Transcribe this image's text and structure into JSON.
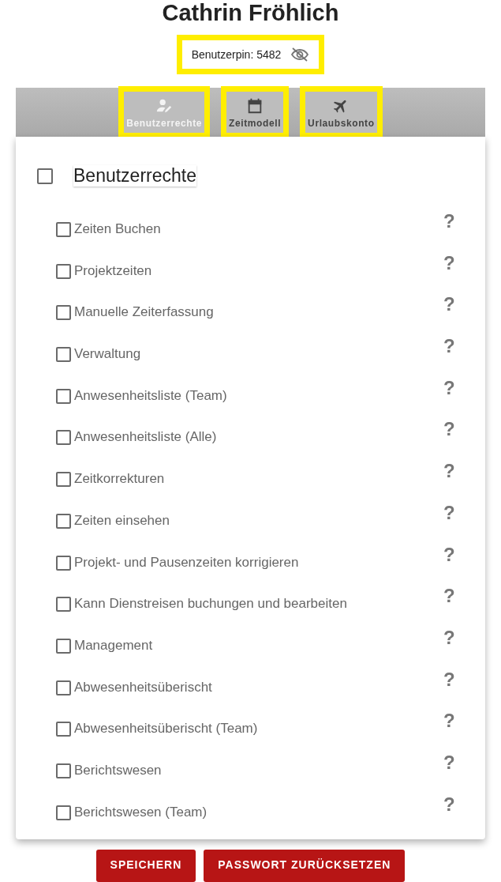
{
  "title": "Cathrin Fröhlich",
  "pin": {
    "label": "Benutzerpin: 5482",
    "highlighted": true
  },
  "tabs": [
    {
      "label": "Benutzerrechte",
      "selected": true,
      "highlighted": true
    },
    {
      "label": "Zeitmodell",
      "selected": false,
      "highlighted": true
    },
    {
      "label": "Urlaubskonto",
      "selected": false,
      "highlighted": true
    }
  ],
  "section": {
    "title": "Benutzerrechte",
    "checked": false
  },
  "permissions": [
    {
      "label": "Zeiten Buchen",
      "checked": false,
      "help": "?"
    },
    {
      "label": "Projektzeiten",
      "checked": false,
      "help": "?"
    },
    {
      "label": "Manuelle Zeiterfassung",
      "checked": false,
      "help": "?"
    },
    {
      "label": "Verwaltung",
      "checked": false,
      "help": "?"
    },
    {
      "label": "Anwesenheitsliste (Team)",
      "checked": false,
      "help": "?"
    },
    {
      "label": "Anwesenheitsliste (Alle)",
      "checked": false,
      "help": "?"
    },
    {
      "label": "Zeitkorrekturen",
      "checked": false,
      "help": "?"
    },
    {
      "label": "Zeiten einsehen",
      "checked": false,
      "help": "?"
    },
    {
      "label": "Projekt- und Pausenzeiten korrigieren",
      "checked": false,
      "help": "?"
    },
    {
      "label": "Kann Dienstreisen buchungen und bearbeiten",
      "checked": false,
      "help": "?"
    },
    {
      "label": "Management",
      "checked": false,
      "help": "?"
    },
    {
      "label": "Abwesenheitsüberischt",
      "checked": false,
      "help": "?"
    },
    {
      "label": "Abwesenheitsüberischt (Team)",
      "checked": false,
      "help": "?"
    },
    {
      "label": "Berichtswesen",
      "checked": false,
      "help": "?"
    },
    {
      "label": "Berichtswesen (Team)",
      "checked": false,
      "help": "?"
    }
  ],
  "buttons": [
    "SPEICHERN",
    "PASSWORT ZURÜCKSETZEN"
  ]
}
